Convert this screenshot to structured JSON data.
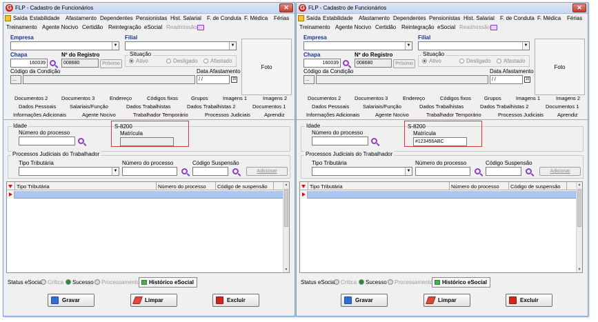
{
  "window": {
    "title": "FLP - Cadastro de Funcionários",
    "app_icon_letter": "G",
    "close_glyph": "✕"
  },
  "menu": {
    "row1": [
      "Saída",
      "Estabilidade",
      "Afastamento",
      "Dependentes",
      "Pensionistas",
      "Hist. Salarial",
      "F. de Conduta",
      "F. Médica",
      "Férias"
    ],
    "row2": [
      "Treinamento",
      "Agente Nocivo",
      "Certidão",
      "Reintegração",
      "eSocial",
      "Readmissão"
    ]
  },
  "header": {
    "empresa_label": "Empresa",
    "filial_label": "Filial",
    "chapa_label": "Chapa",
    "chapa_value": "160039",
    "registro_label": "Nº do Registro",
    "registro_value": "008680",
    "proximo_label": "Próximo",
    "situacao_label": "Situação",
    "situacao_options": [
      "Ativo",
      "Desligado",
      "Afastado"
    ],
    "situacao_selected": "Ativo",
    "condicao_label": "Código da Condição",
    "condicao_value": "...",
    "data_afastamento_label": "Data Afastamento",
    "data_afastamento_value": "/ /",
    "foto_label": "Foto"
  },
  "tabs": {
    "row1": [
      "Documentos 2",
      "Documentos 3",
      "Endereço",
      "Códigos fixos",
      "Grupos",
      "Imagens 1",
      "Imagens 2"
    ],
    "row2": [
      "Dados Pessoais",
      "Salariais/Função",
      "Dados Trabalhistas",
      "Dados Trabalhistas 2",
      "Documentos 1"
    ],
    "row3": [
      "Informações Adicionais",
      "Agente Nocivo",
      "Trabalhador Temporário",
      "Processos Judiciais",
      "Aprendiz"
    ],
    "active": "Processos Judiciais"
  },
  "panel": {
    "idade_label": "Idade",
    "numero_processo_label": "Número do processo",
    "s8200_label": "S-8200",
    "matricula_label": "Matrícula",
    "processos_group_label": "Processos Judiciais do Trabalhador",
    "tipo_tributaria_label": "Tipo Tributária",
    "numero_processo2_label": "Número do processo",
    "codigo_suspensao_label": "Código Suspensão",
    "adicionar_label": "Adicionar"
  },
  "grid": {
    "columns": [
      "Tipo Tributária",
      "Número do processo",
      "Código de suspensão"
    ]
  },
  "status": {
    "label": "Status eSocial:",
    "critica": "Crítica",
    "sucesso": "Sucesso",
    "processamento": "Processamento",
    "historico": "Histórico eSocial",
    "colors": {
      "critica": "#d9d9d9",
      "sucesso": "#1f8f2f",
      "processamento": "#d9d9d9"
    }
  },
  "footer": {
    "gravar": "Gravar",
    "limpar": "Limpar",
    "excluir": "Excluir"
  },
  "left": {
    "matricula_value": ""
  },
  "right": {
    "matricula_value": "#123456ABC"
  }
}
